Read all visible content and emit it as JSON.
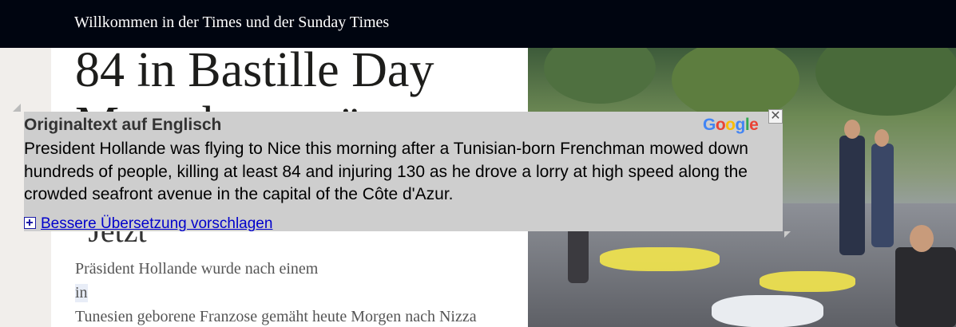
{
  "header": {
    "welcome_text": "Willkommen in der Times und der Sunday Times"
  },
  "article": {
    "headline_line1": "84 in Bastille Day",
    "headline_line2": "Massaker getötet",
    "headline_partial": "\"Jetzt",
    "body_line1": "Präsident Hollande wurde nach einem",
    "body_line2": "in",
    "body_line3": "Tunesien geborene Franzose gemäht heute Morgen nach Nizza"
  },
  "translate_popup": {
    "title": "Originaltext auf Englisch",
    "original_text": "President Hollande was flying to Nice this morning after a Tunisian-born Frenchman mowed down hundreds of people, killing at least 84 and injuring 130 as he drove a lorry at high speed along the crowded seafront avenue in the capital of the Côte d'Azur.",
    "suggest_link": "Bessere Übersetzung vorschlagen",
    "close_symbol": "✕",
    "logo_letters": [
      "G",
      "o",
      "o",
      "g",
      "l",
      "e"
    ]
  },
  "photo": {
    "description_icon": "news-photo"
  },
  "colors": {
    "topbar_bg": "#000510",
    "popup_bg": "#cecece",
    "link": "#0000cc"
  }
}
